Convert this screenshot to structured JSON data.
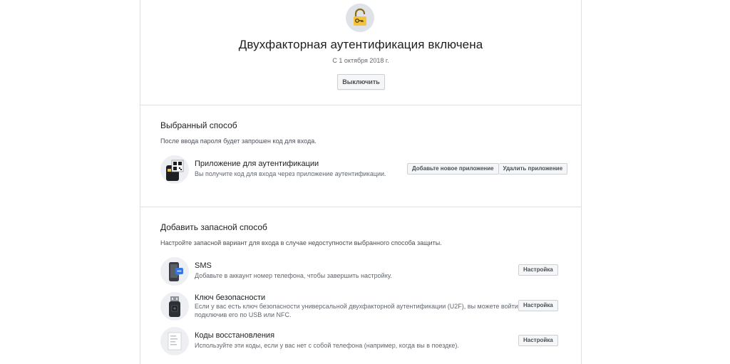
{
  "hero": {
    "title": "Двухфакторная аутентификация включена",
    "since": "С 1 октября 2018 г.",
    "turn_off_label": "Выключить"
  },
  "selected_method": {
    "title": "Выбранный способ",
    "description": "После ввода пароля будет запрошен код для входа.",
    "item": {
      "icon": "authenticator-app-icon",
      "title": "Приложение для аутентификации",
      "description": "Вы получите код для входа через приложение аутентификации.",
      "add_app_label": "Добавьте новое приложение",
      "remove_app_label": "Удалить приложение"
    }
  },
  "backup": {
    "title": "Добавить запасной способ",
    "description": "Настройте запасной вариант для входа в случае недоступности выбранного способа защиты.",
    "items": [
      {
        "icon": "phone-sms-icon",
        "title": "SMS",
        "description": "Добавьте в аккаунт номер телефона, чтобы завершить настройку.",
        "button": "Настройка"
      },
      {
        "icon": "usb-key-icon",
        "title": "Ключ безопасности",
        "description_line1": "Если у вас есть ключ безопасности универсальной двухфакторной аутентификации (U2F), вы можете войти,",
        "description_line2": "подключив его по USB или NFC.",
        "button": "Настройка"
      },
      {
        "icon": "recovery-codes-icon",
        "title": "Коды восстановления",
        "description": "Используйте эти коды, если у вас нет с собой телефона (например, когда вы в поездке).",
        "button": "Настройка"
      }
    ]
  },
  "colors": {
    "border": "#dddfe2",
    "button_bg": "#f5f6f7",
    "lock_yellow": "#f5c33b",
    "icon_blue": "#3578e5"
  }
}
